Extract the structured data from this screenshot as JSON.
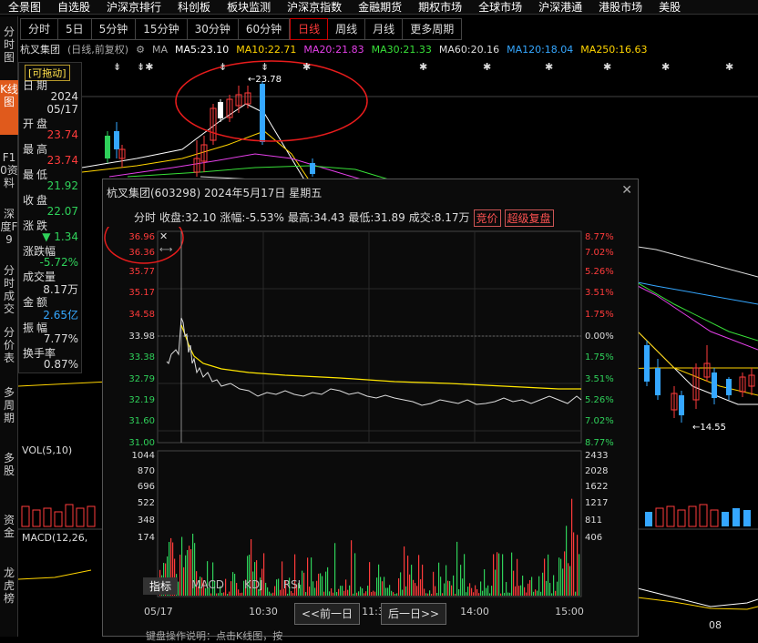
{
  "topbar": {
    "left": "全景图",
    "items": [
      "自选股",
      "沪深京排行",
      "科创板",
      "板块监测",
      "沪深京指数",
      "金融期货",
      "期权市场",
      "全球市场",
      "沪深港通",
      "港股市场",
      "美股"
    ]
  },
  "tabs": [
    "分时",
    "5日",
    "5分钟",
    "15分钟",
    "30分钟",
    "60分钟",
    "日线",
    "周线",
    "月线",
    "更多周期"
  ],
  "active_tab": "日线",
  "sidebar": [
    "分时图",
    "K线图",
    "F10资料",
    "深度F9",
    "分时成交",
    "分价表",
    "多周期",
    "多股",
    "资金",
    "龙虎榜"
  ],
  "stock": {
    "name": "杭叉集团",
    "mode": "(日线,前复权)"
  },
  "ma": [
    {
      "label": "MA5:23.10",
      "color": "#ffffff"
    },
    {
      "label": "MA10:22.71",
      "color": "#ffd400"
    },
    {
      "label": "MA20:21.83",
      "color": "#e43fe8"
    },
    {
      "label": "MA30:21.33",
      "color": "#38e038"
    },
    {
      "label": "MA60:20.16",
      "color": "#dddddd"
    },
    {
      "label": "MA120:18.04",
      "color": "#35a7ff"
    },
    {
      "label": "MA250:16.63",
      "color": "#ffd400"
    }
  ],
  "ma_prefix": "MA",
  "panel": {
    "drag": "[可拖动]",
    "date_label": "日期",
    "date1": "2024",
    "date2": "05/17",
    "open_label": "开盘",
    "open": "23.74",
    "high_label": "最高",
    "high": "23.74",
    "low_label": "最低",
    "low": "21.92",
    "close_label": "收盘",
    "close": "22.07",
    "chg_label": "涨跌",
    "chg": "▼ 1.34",
    "pct_label": "涨跌幅",
    "pct": "-5.72%",
    "vol_label": "成交量",
    "vol": "8.17万",
    "amt_label": "金额",
    "amt": "2.65亿",
    "amp_label": "振幅",
    "amp": "7.77%",
    "turn_label": "换手率",
    "turn": "0.87%"
  },
  "kline": {
    "high_label": "23.78",
    "low_label": "14.55",
    "vol_label": "VOL(5,10)",
    "macd_label": "MACD(12,26,",
    "bottom_tick": "08"
  },
  "popup": {
    "title": "杭叉集团(603298) 2024年5月17日 星期五",
    "mode": "分时",
    "close": "收盘:32.10",
    "chg": "涨幅:-5.53%",
    "high": "最高:34.43",
    "low": "最低:31.89",
    "vol": "成交:8.17万",
    "btn1": "竞价",
    "btn2": "超级复盘",
    "price_ticks": [
      "36.96",
      "36.36",
      "35.77",
      "35.17",
      "34.58",
      "33.98",
      "33.38",
      "32.79",
      "32.19",
      "31.60",
      "31.00"
    ],
    "pct_ticks": [
      "8.77%",
      "7.02%",
      "5.26%",
      "3.51%",
      "1.75%",
      "0.00%",
      "1.75%",
      "3.51%",
      "5.26%",
      "7.02%",
      "8.77%"
    ],
    "vol_ticks_left": [
      "1044",
      "870",
      "696",
      "522",
      "348",
      "174"
    ],
    "vol_ticks_right": [
      "2433",
      "2028",
      "1622",
      "1217",
      "811",
      "406"
    ],
    "time_ticks": [
      "05/17",
      "10:30",
      "11:30",
      "14:00",
      "15:00"
    ],
    "indicators": [
      "指标",
      "MACD",
      "KDJ",
      "RSI"
    ],
    "prev": "<<前一日",
    "next": "后一日>>"
  },
  "hint": "键盘操作说明：点击K线图，按"
}
